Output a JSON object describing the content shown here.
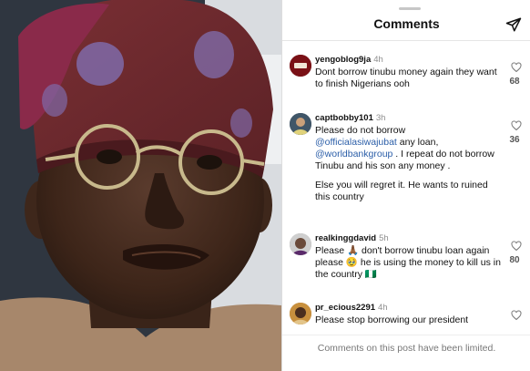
{
  "panel": {
    "title": "Comments",
    "footer": "Comments on this post have been limited."
  },
  "comments": [
    {
      "username": "yengoblog9ja",
      "time": "4h",
      "lines": [
        "Dont borrow tinubu money again they want to finish Nigerians ooh"
      ],
      "likes": "68"
    },
    {
      "username": "captbobby101",
      "time": "3h",
      "line1": "Please do not borrow",
      "mention1": "@officialasiwajubat",
      "after_mention1": " any loan,",
      "mention2": "@worldbankgroup",
      "after_mention2": " . I repeat do not borrow Tinubu and his son any money .",
      "line_last": "Else you will regret it. He wants to ruined this country",
      "likes": "36"
    },
    {
      "username": "realkinggdavid",
      "time": "5h",
      "text": "Please 🙏🏾 don't borrow tinubu loan again please 🥹 he is using the money to kill us in the country 🇳🇬",
      "likes": "80"
    },
    {
      "username": "pr_ecious2291",
      "time": "4h",
      "text": "Please stop borrowing our president"
    }
  ],
  "icons": {
    "share": "paper-plane-icon",
    "like": "heart-icon"
  },
  "colors": {
    "mention": "#2b5ea8",
    "muted": "#8e8e8e"
  }
}
